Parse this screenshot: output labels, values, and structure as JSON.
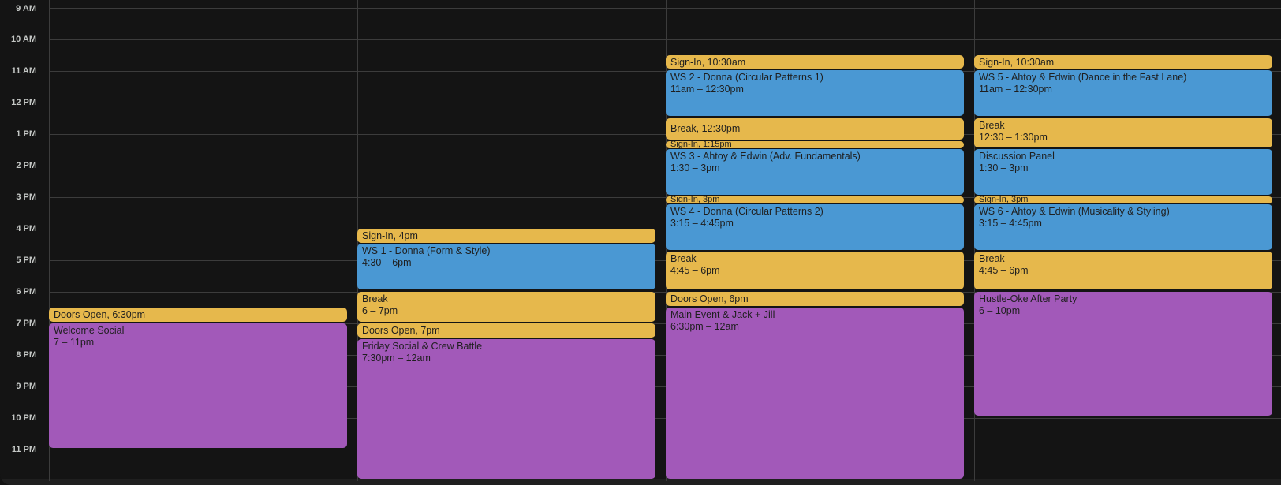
{
  "hours": [
    "9 AM",
    "10 AM",
    "11 AM",
    "12 PM",
    "1 PM",
    "2 PM",
    "3 PM",
    "4 PM",
    "5 PM",
    "6 PM",
    "7 PM",
    "8 PM",
    "9 PM",
    "10 PM",
    "11 PM"
  ],
  "colors": {
    "background": "#141414",
    "gridline": "#3c3c3c",
    "signin_break": "#e6b84c",
    "workshop": "#4a98d3",
    "social": "#a259b9"
  },
  "days": [
    {
      "events": [
        {
          "title": "Doors Open",
          "time": "6:30pm",
          "inline": true,
          "color": "yellow"
        },
        {
          "title": "Welcome Social",
          "time": "7 – 11pm",
          "color": "purple"
        }
      ]
    },
    {
      "events": [
        {
          "title": "Sign-In",
          "time": "4pm",
          "inline": true,
          "color": "yellow"
        },
        {
          "title": "WS 1 - Donna (Form & Style)",
          "time": "4:30 – 6pm",
          "color": "blue"
        },
        {
          "title": "Break",
          "time": "6 – 7pm",
          "color": "yellow"
        },
        {
          "title": "Doors Open",
          "time": "7pm",
          "inline": true,
          "color": "yellow"
        },
        {
          "title": "Friday Social & Crew Battle",
          "time": "7:30pm – 12am",
          "color": "purple"
        }
      ]
    },
    {
      "events": [
        {
          "title": "Sign-In",
          "time": "10:30am",
          "inline": true,
          "color": "yellow"
        },
        {
          "title": "WS 2 - Donna (Circular Patterns 1)",
          "time": "11am – 12:30pm",
          "color": "blue"
        },
        {
          "title": "Break",
          "time": "12:30pm",
          "inline": true,
          "color": "yellow"
        },
        {
          "title": "Sign-In",
          "time": "1:15pm",
          "inline": true,
          "color": "yellow"
        },
        {
          "title": "WS 3 - Ahtoy & Edwin (Adv. Fundamentals)",
          "time": "1:30 – 3pm",
          "color": "blue"
        },
        {
          "title": "Sign-In",
          "time": "3pm",
          "inline": true,
          "color": "yellow"
        },
        {
          "title": "WS 4 - Donna (Circular Patterns 2)",
          "time": "3:15 – 4:45pm",
          "color": "blue"
        },
        {
          "title": "Break",
          "time": "4:45 – 6pm",
          "color": "yellow"
        },
        {
          "title": "Doors Open",
          "time": "6pm",
          "inline": true,
          "color": "yellow"
        },
        {
          "title": "Main Event & Jack + Jill",
          "time": "6:30pm – 12am",
          "color": "purple"
        }
      ]
    },
    {
      "events": [
        {
          "title": "Sign-In",
          "time": "10:30am",
          "inline": true,
          "color": "yellow"
        },
        {
          "title": "WS 5 - Ahtoy & Edwin (Dance in the Fast Lane)",
          "time": "11am – 12:30pm",
          "color": "blue"
        },
        {
          "title": "Break",
          "time": "12:30 – 1:30pm",
          "color": "yellow"
        },
        {
          "title": "Discussion Panel",
          "time": "1:30 – 3pm",
          "color": "blue"
        },
        {
          "title": "Sign-In",
          "time": "3pm",
          "inline": true,
          "color": "yellow"
        },
        {
          "title": "WS 6 - Ahtoy & Edwin (Musicality & Styling)",
          "time": "3:15 – 4:45pm",
          "color": "blue"
        },
        {
          "title": "Break",
          "time": "4:45 – 6pm",
          "color": "yellow"
        },
        {
          "title": "Hustle-Oke After Party",
          "time": "6 – 10pm",
          "color": "purple"
        }
      ]
    }
  ]
}
